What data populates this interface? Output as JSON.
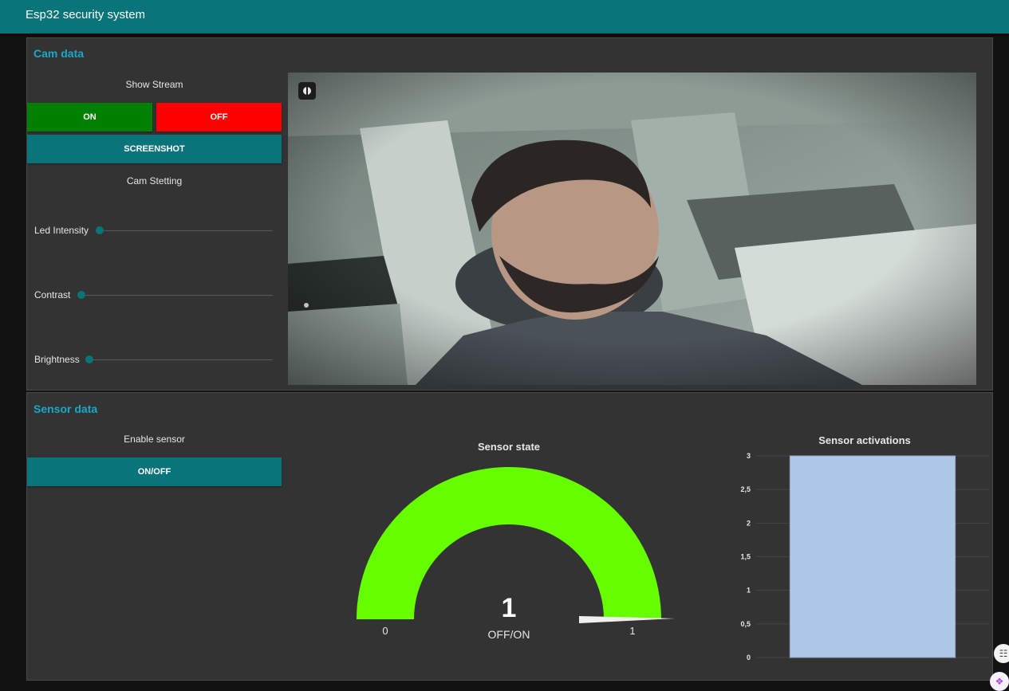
{
  "app": {
    "title": "Esp32 security system"
  },
  "cam_card": {
    "title": "Cam data",
    "show_stream_label": "Show Stream",
    "on_label": "ON",
    "off_label": "OFF",
    "screenshot_label": "SCREENSHOT",
    "cam_setting_label": "Cam Stetting",
    "sliders": [
      {
        "label": "Led Intensity",
        "value": 0
      },
      {
        "label": "Contrast",
        "value": 0
      },
      {
        "label": "Brightness",
        "value": 0
      }
    ]
  },
  "sensor_card": {
    "title": "Sensor data",
    "enable_label": "Enable sensor",
    "toggle_label": "ON/OFF",
    "gauge": {
      "title": "Sensor state",
      "value": "1",
      "unit": "OFF/ON",
      "min": "0",
      "max": "1",
      "color": "#66ff00"
    },
    "chart_data": {
      "type": "bar",
      "title": "Sensor activations",
      "categories": [
        ""
      ],
      "values": [
        3
      ],
      "ylim": [
        0,
        3
      ],
      "yticks": [
        "0",
        "0,5",
        "1",
        "1,5",
        "2",
        "2,5",
        "3"
      ],
      "bar_color": "#aec7e8",
      "grid": true
    }
  },
  "colors": {
    "accent": "#097479",
    "on": "#008000",
    "off": "#ff0000",
    "card_title": "#19a8c9"
  },
  "icons": [
    "camera-icon",
    "translate-icon",
    "extension-icon"
  ]
}
